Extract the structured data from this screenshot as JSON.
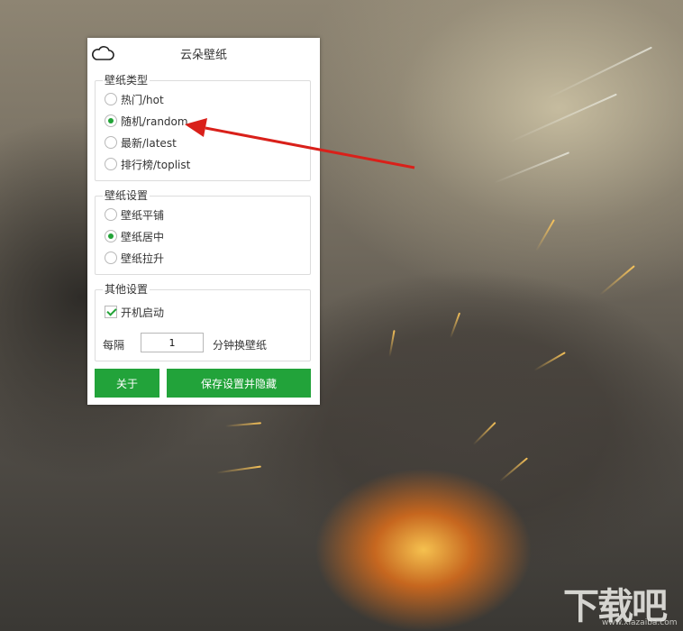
{
  "window": {
    "title": "云朵壁纸",
    "cloud_icon": "cloud-icon"
  },
  "wallpaper_type": {
    "legend": "壁纸类型",
    "options": [
      {
        "label": "热门/hot",
        "selected": false
      },
      {
        "label": "随机/random",
        "selected": true
      },
      {
        "label": "最新/latest",
        "selected": false
      },
      {
        "label": "排行榜/toplist",
        "selected": false
      }
    ]
  },
  "wallpaper_settings": {
    "legend": "壁纸设置",
    "options": [
      {
        "label": "壁纸平铺",
        "selected": false
      },
      {
        "label": "壁纸居中",
        "selected": true
      },
      {
        "label": "壁纸拉升",
        "selected": false
      }
    ]
  },
  "other_settings": {
    "legend": "其他设置",
    "autostart_label": "开机启动",
    "autostart_checked": true,
    "interval_prefix": "每隔",
    "interval_value": "1",
    "interval_suffix": "分钟换壁纸"
  },
  "buttons": {
    "about": "关于",
    "save_hide": "保存设置并隐藏"
  },
  "colors": {
    "accent_green": "#22a33a",
    "arrow_red": "#d9201a"
  },
  "watermark": {
    "text": "下载吧",
    "sub": "www.xiazaiba.com"
  }
}
